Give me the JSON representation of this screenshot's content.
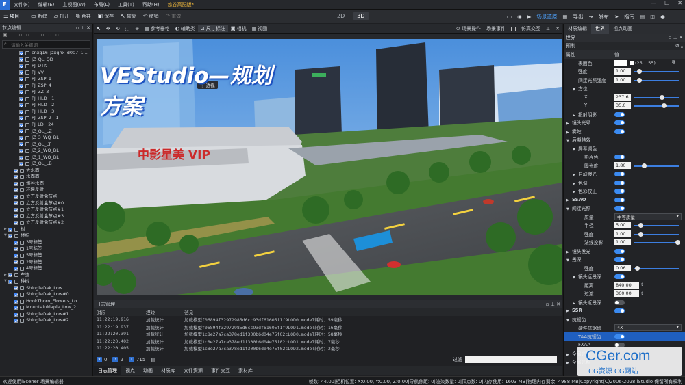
{
  "menubar": {
    "items": [
      "文件(F)",
      "编辑(E)",
      "主视图(W)",
      "布局(L)",
      "工具(T)",
      "帮助(H)"
    ],
    "doc_title": "悠谷高配版*",
    "window_controls": [
      "—",
      "☐",
      "✕"
    ]
  },
  "toolbar": {
    "project": "项目",
    "buttons": [
      "新建",
      "打开",
      "合并",
      "保存",
      "恢复",
      "撤销",
      "重做"
    ],
    "mode_tabs": [
      "2D",
      "3D"
    ],
    "active_mode": "3D",
    "scene_restore": "场景还原",
    "export": "导出",
    "publish": "发布",
    "guide": "指南"
  },
  "left_panel": {
    "title": "节点编辑",
    "search_placeholder": "请输入关键词",
    "items": [
      {
        "label": "cnxq16_Jzxghx_d007_1...",
        "type": "cb",
        "indent": 2
      },
      {
        "label": "JZ_QL_QD",
        "type": "cb",
        "indent": 2
      },
      {
        "label": "PJ_DTK",
        "type": "cb",
        "indent": 2
      },
      {
        "label": "PJ_VV",
        "type": "cb",
        "indent": 2
      },
      {
        "label": "PJ_ZSP_1",
        "type": "cb",
        "indent": 2
      },
      {
        "label": "PJ_ZSP_4",
        "type": "cb",
        "indent": 2
      },
      {
        "label": "PJ_ZZ_3",
        "type": "cb",
        "indent": 2
      },
      {
        "label": "PJ_HLD__1_",
        "type": "cb",
        "indent": 2
      },
      {
        "label": "PJ_HLD__2_",
        "type": "cb",
        "indent": 2
      },
      {
        "label": "PJ_HLD__3_",
        "type": "cb",
        "indent": 2
      },
      {
        "label": "PJ_ZSP_2__1_",
        "type": "cb",
        "indent": 2
      },
      {
        "label": "PJ_LD__24_",
        "type": "cb",
        "indent": 2
      },
      {
        "label": "JZ_QL_LZ",
        "type": "cb",
        "indent": 2
      },
      {
        "label": "JZ_3_WQ_BL",
        "type": "cb",
        "indent": 2
      },
      {
        "label": "JZ_QL_LT",
        "type": "cb",
        "indent": 2
      },
      {
        "label": "JZ_2_WQ_BL",
        "type": "cb",
        "indent": 2
      },
      {
        "label": "JZ_1_WQ_BL",
        "type": "cb",
        "indent": 2
      },
      {
        "label": "JZ_QL_LB",
        "type": "cb",
        "indent": 2
      },
      {
        "label": "大水面",
        "type": "cb",
        "indent": 1
      },
      {
        "label": "水面面",
        "type": "cb",
        "indent": 1
      },
      {
        "label": "悠谷水面",
        "type": "cb",
        "indent": 1
      },
      {
        "label": "环境反射",
        "type": "cb",
        "indent": 1
      },
      {
        "label": "立方反射盒节点",
        "type": "cb",
        "indent": 1
      },
      {
        "label": "立方反射盒节点#0",
        "type": "cb",
        "indent": 1
      },
      {
        "label": "立方反射盒节点#1",
        "type": "cb",
        "indent": 1
      },
      {
        "label": "立方反射盒节点#3",
        "type": "cb",
        "indent": 1
      },
      {
        "label": "立方反射盒节点#2",
        "type": "cb",
        "indent": 1
      },
      {
        "label": "树",
        "type": "cb",
        "indent": 0,
        "arrow": "▶"
      },
      {
        "label": "楼标",
        "type": "cb",
        "indent": 0,
        "arrow": "▼"
      },
      {
        "label": "3号标签",
        "type": "cb",
        "indent": 1
      },
      {
        "label": "1号标签",
        "type": "cb",
        "indent": 1
      },
      {
        "label": "5号标签",
        "type": "cb",
        "indent": 1
      },
      {
        "label": "2号标签",
        "type": "cb",
        "indent": 1
      },
      {
        "label": "4号标签",
        "type": "cb",
        "indent": 1
      },
      {
        "label": "车流",
        "type": "cb",
        "indent": 0,
        "arrow": "▶"
      },
      {
        "label": "种树",
        "type": "cb",
        "indent": 0,
        "arrow": "▼"
      },
      {
        "label": "ShingleOak_Low",
        "type": "cb",
        "indent": 1
      },
      {
        "label": "ShingleOak_Low#0",
        "type": "cb",
        "indent": 1
      },
      {
        "label": "HookThorn_Flowers_Lo...",
        "type": "cb",
        "indent": 1
      },
      {
        "label": "MountainMaple_Low_2",
        "type": "cb",
        "indent": 1
      },
      {
        "label": "ShingleOak_Low#1",
        "type": "cb",
        "indent": 1
      },
      {
        "label": "ShingleOak_Low#2",
        "type": "cb",
        "indent": 1
      }
    ]
  },
  "viewport_toolbar": {
    "items": [
      "参考栅格",
      "辅助类",
      "尺寸标注",
      "相机",
      "视图"
    ],
    "active": "尺寸标注",
    "right_items": [
      "场景操作",
      "场景事件",
      "仿真交互"
    ]
  },
  "viewport": {
    "perspective_label": "透视",
    "banner": "VEStudio—规划方案",
    "sign_text": "中影星美 VIP"
  },
  "log": {
    "title": "日志管理",
    "columns": [
      "时间",
      "模块",
      "消息"
    ],
    "rows": [
      [
        "11:22:19.916",
        "加载统计",
        "加载模型f06894f32972985d6cc93df61605f1f9LOD0.model耗时：59毫秒"
      ],
      [
        "11:22:19.937",
        "加载统计",
        "加载模型f06894f32972985d6cc93df61605f1f9LOD1.model耗时：16毫秒"
      ],
      [
        "11:22:20.391",
        "加载统计",
        "加载模型1c8e27a7ca378ed1f300b6d04e75f02cLOD0.model耗时：58毫秒"
      ],
      [
        "11:22:20.402",
        "加载统计",
        "加载模型1c8e27a7ca378ed1f300b6d04e75f02cLOD1.model耗时：7毫秒"
      ],
      [
        "11:22:20.405",
        "加载统计",
        "加载模型1c8e27a7ca378ed1f300b6d04e75f02cLOD2.model耗时：2毫秒"
      ]
    ],
    "counts": [
      "0",
      "2",
      "715"
    ],
    "filter_label": "过滤"
  },
  "bottom_tabs": [
    "日志管理",
    "视点",
    "动画",
    "材质库",
    "文件资源",
    "事件交互",
    "素材库"
  ],
  "right_panel": {
    "tabs": [
      "材质编辑",
      "世界",
      "视点动画"
    ],
    "active_tab": "世界",
    "section": "世界",
    "preset": "预制",
    "col_prop": "属性",
    "col_val": "值",
    "props": [
      {
        "label": "表面色",
        "indent": 1,
        "kind": "color",
        "val": "(25....55)"
      },
      {
        "label": "强度",
        "indent": 1,
        "kind": "slider",
        "val": "1.00",
        "pos": 0.08
      },
      {
        "label": "间接光照强度",
        "indent": 1,
        "kind": "slider",
        "val": "1.00",
        "pos": 0.08
      },
      {
        "label": "方位",
        "indent": 1,
        "kind": "head",
        "arrow": "▼"
      },
      {
        "label": "X",
        "indent": 2,
        "kind": "slider",
        "val": "237.6",
        "pos": 0.62
      },
      {
        "label": "Y",
        "indent": 2,
        "kind": "slider",
        "val": "35.0",
        "pos": 0.66
      },
      {
        "label": "投射阴影",
        "indent": 1,
        "kind": "toggle",
        "on": true,
        "arrow": "▶"
      },
      {
        "label": "镜头光晕",
        "indent": 0,
        "kind": "toggle",
        "on": true,
        "arrow": "▶"
      },
      {
        "label": "雾效",
        "indent": 0,
        "kind": "toggle",
        "on": true,
        "arrow": "▶"
      },
      {
        "label": "后期特效",
        "indent": 0,
        "kind": "head",
        "arrow": "▼"
      },
      {
        "label": "屏幕调色",
        "indent": 1,
        "kind": "head",
        "arrow": "▼"
      },
      {
        "label": "影片色",
        "indent": 2,
        "kind": "toggle",
        "on": true
      },
      {
        "label": "曝光度",
        "indent": 2,
        "kind": "slider",
        "val": "1.80",
        "pos": 0.2
      },
      {
        "label": "自动曝光",
        "indent": 1,
        "kind": "toggle",
        "on": true,
        "arrow": "▶"
      },
      {
        "label": "色调",
        "indent": 1,
        "kind": "toggle",
        "on": true,
        "arrow": "▶"
      },
      {
        "label": "色彩校正",
        "indent": 1,
        "kind": "toggle",
        "on": true,
        "arrow": "▶"
      },
      {
        "label": "SSAO",
        "indent": 0,
        "kind": "toggle",
        "on": true,
        "arrow": "▶",
        "bold": true
      },
      {
        "label": "间接光照",
        "indent": 0,
        "kind": "toggle",
        "on": true,
        "arrow": "▼"
      },
      {
        "label": "质量",
        "indent": 2,
        "kind": "select",
        "val": "中等质量"
      },
      {
        "label": "半径",
        "indent": 2,
        "kind": "slider",
        "val": "5.00",
        "pos": 0.12
      },
      {
        "label": "强度",
        "indent": 2,
        "kind": "slider",
        "val": "1.00",
        "pos": 0.12
      },
      {
        "label": "法线投影",
        "indent": 2,
        "kind": "slider",
        "val": "1.00",
        "pos": 0.98
      },
      {
        "label": "镜头发光",
        "indent": 0,
        "kind": "toggle",
        "on": true,
        "arrow": "▶"
      },
      {
        "label": "景深",
        "indent": 0,
        "kind": "toggle",
        "on": true,
        "arrow": "▼"
      },
      {
        "label": "强度",
        "indent": 2,
        "kind": "slider",
        "val": "0.06",
        "pos": 0.04
      },
      {
        "label": "镜头远景深",
        "indent": 1,
        "kind": "toggle",
        "on": true,
        "arrow": "▼"
      },
      {
        "label": "距离",
        "indent": 2,
        "kind": "input",
        "val": "840.00"
      },
      {
        "label": "过渡",
        "indent": 2,
        "kind": "input",
        "val": "360.00"
      },
      {
        "label": "镜头近景深",
        "indent": 1,
        "kind": "toggle",
        "on": false,
        "arrow": "▶"
      },
      {
        "label": "SSR",
        "indent": 0,
        "kind": "toggle",
        "on": true,
        "arrow": "▶",
        "bold": true
      },
      {
        "label": "抗锯齿",
        "indent": 0,
        "kind": "head",
        "arrow": "▼"
      },
      {
        "label": "硬件抗锯齿",
        "indent": 1,
        "kind": "select",
        "val": "4X"
      },
      {
        "label": "TAA抗锯齿",
        "indent": 1,
        "kind": "toggle",
        "on": true,
        "highlight": true
      },
      {
        "label": "FXAA",
        "indent": 1,
        "kind": "toggle",
        "on": false
      },
      {
        "label": "全局光照",
        "indent": 0,
        "kind": "head",
        "arrow": "▶"
      },
      {
        "label": "全局光照",
        "indent": 0,
        "kind": "head",
        "arrow": "▶"
      }
    ]
  },
  "status": {
    "left": "欢迎使用iScener 场景编辑器",
    "right": "帧数: 44.00|相机位置: X:0.00, Y:0.00, Z:0.00|导航焦距: 0|渲染数量: 0|顶点数: 0|内存使用: 1603 MB|物理内存剩余: 4988 MB|Copyright(C)2006-2028 iStudio 保留所有权利"
  },
  "watermark": {
    "main": "CGer.com",
    "sub": "CG资源 CG网站"
  },
  "colors": {
    "accent": "#4ea3ff",
    "toggle_on": "#3b8af0",
    "highlight": "#1f5fbf"
  }
}
